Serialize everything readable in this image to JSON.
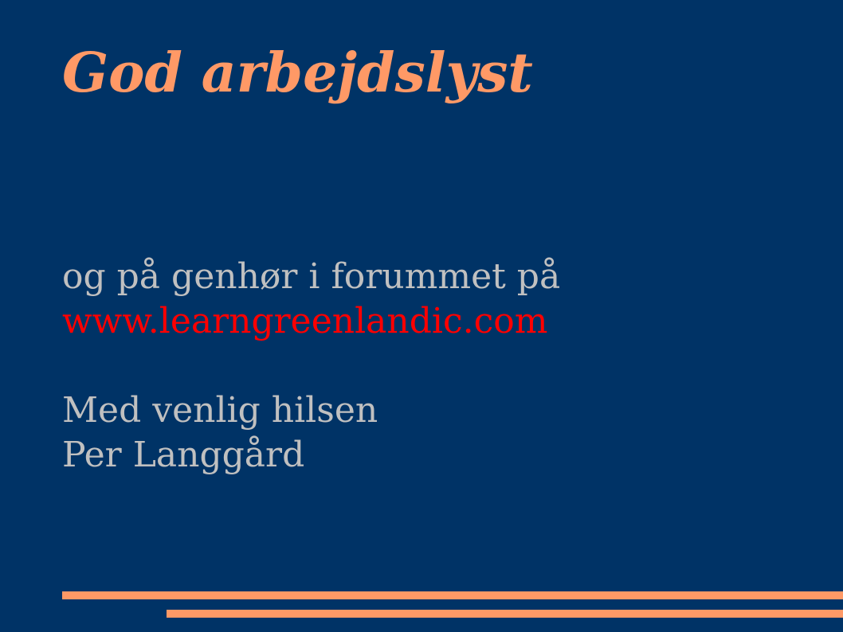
{
  "slide": {
    "title": "God arbejdslyst",
    "line1": "og på genhør i forummet på",
    "link": "www.learngreenlandic.com",
    "closing": "Med venlig hilsen",
    "signature": "Per Langgård"
  },
  "colors": {
    "background": "#003366",
    "accent": "#ff9966",
    "text": "#c0c0c0",
    "link": "#ff0000"
  }
}
